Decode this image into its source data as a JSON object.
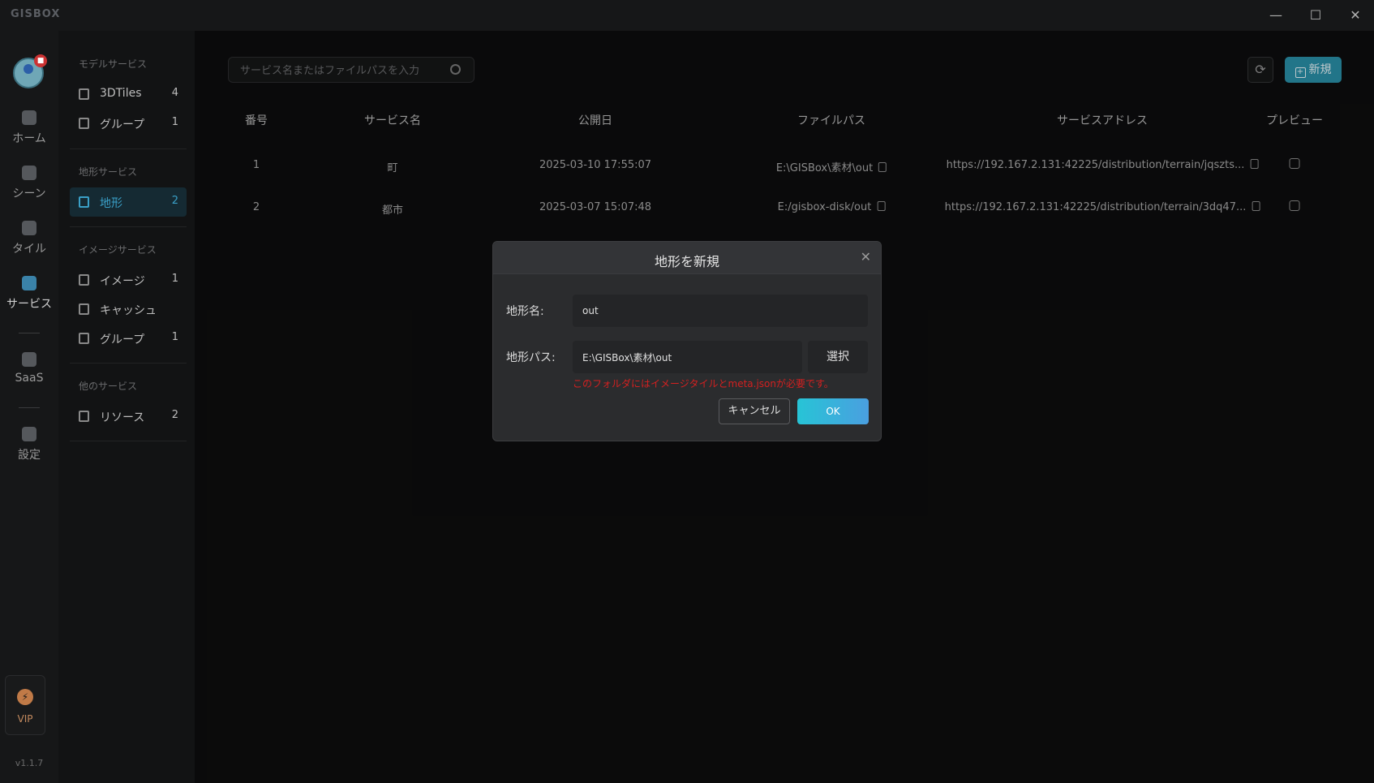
{
  "app": {
    "logo": "GISBOX",
    "version": "v1.1.7"
  },
  "window": {
    "minimize": "—",
    "maximize": "☐",
    "close": "✕"
  },
  "avatar": {
    "badge": "■"
  },
  "rail": [
    {
      "label": "ホーム"
    },
    {
      "label": "シーン"
    },
    {
      "label": "タイル"
    },
    {
      "label": "サービス"
    },
    {
      "label": "SaaS"
    },
    {
      "label": "設定"
    }
  ],
  "vip": {
    "label": "VIP"
  },
  "subnav": {
    "groups": [
      {
        "title": "モデルサービス",
        "items": [
          {
            "label": "3DTiles",
            "count": "4"
          },
          {
            "label": "グループ",
            "count": "1"
          }
        ]
      },
      {
        "title": "地形サービス",
        "items": [
          {
            "label": "地形",
            "count": "2"
          }
        ]
      },
      {
        "title": "イメージサービス",
        "items": [
          {
            "label": "イメージ",
            "count": "1"
          },
          {
            "label": "キャッシュ",
            "count": ""
          },
          {
            "label": "グループ",
            "count": "1"
          }
        ]
      },
      {
        "title": "他のサービス",
        "items": [
          {
            "label": "リソース",
            "count": "2"
          }
        ]
      }
    ]
  },
  "toolbar": {
    "search_placeholder": "サービス名またはファイルパスを入力",
    "refresh": "⟳",
    "new_label": "新規"
  },
  "table": {
    "headers": [
      "番号",
      "サービス名",
      "公開日",
      "ファイルパス",
      "サービスアドレス",
      "プレビュー"
    ],
    "rows": [
      {
        "no": "1",
        "name": "町",
        "date": "2025-03-10 17:55:07",
        "path": "E:\\GISBox\\素材\\out",
        "address": "https://192.167.2.131:42225/distribution/terrain/jqszts..."
      },
      {
        "no": "2",
        "name": "都市",
        "date": "2025-03-07 15:07:48",
        "path": "E:/gisbox-disk/out",
        "address": "https://192.167.2.131:42225/distribution/terrain/3dq47..."
      }
    ]
  },
  "dialog": {
    "title": "地形を新規",
    "close": "✕",
    "name_label": "地形名:",
    "name_value": "out",
    "path_label": "地形パス:",
    "path_value": "E:\\GISBox\\素材\\out",
    "select_label": "選択",
    "error": "このフォルダにはイメージタイルとmeta.jsonが必要です。",
    "cancel_label": "キャンセル",
    "ok_label": "OK"
  },
  "colors": {
    "accent": "#2a8fa8",
    "error": "#d42020",
    "active_nav": "#3aa0c8"
  }
}
